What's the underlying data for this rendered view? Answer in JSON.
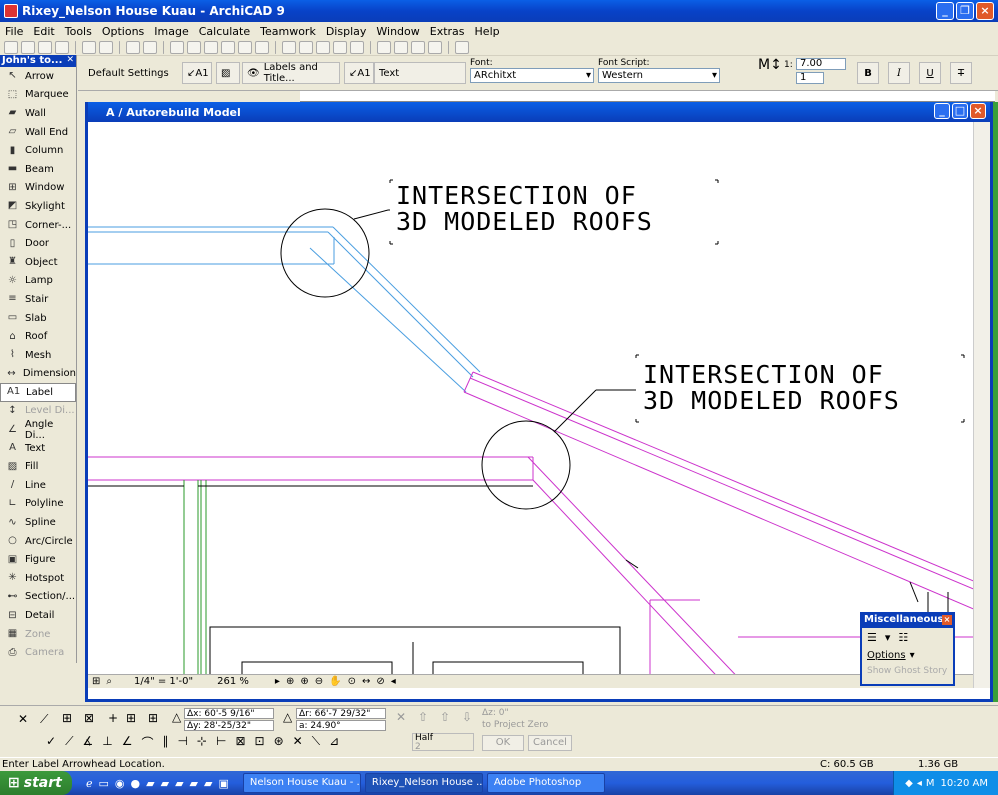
{
  "window": {
    "title": "Rixey_Nelson House Kuau - ArchiCAD 9"
  },
  "menu": [
    "File",
    "Edit",
    "Tools",
    "Options",
    "Image",
    "Calculate",
    "Teamwork",
    "Display",
    "Window",
    "Extras",
    "Help"
  ],
  "toolbox": {
    "title": "John's to...",
    "tools": [
      {
        "label": "Arrow",
        "icon": "arrow-icon",
        "enabled": true
      },
      {
        "label": "Marquee",
        "icon": "marquee-icon",
        "enabled": true
      },
      {
        "label": "Wall",
        "icon": "wall-icon",
        "enabled": true
      },
      {
        "label": "Wall End",
        "icon": "wall-end-icon",
        "enabled": true
      },
      {
        "label": "Column",
        "icon": "column-icon",
        "enabled": true
      },
      {
        "label": "Beam",
        "icon": "beam-icon",
        "enabled": true
      },
      {
        "label": "Window",
        "icon": "window-icon",
        "enabled": true
      },
      {
        "label": "Skylight",
        "icon": "skylight-icon",
        "enabled": true
      },
      {
        "label": "Corner-...",
        "icon": "corner-window-icon",
        "enabled": true
      },
      {
        "label": "Door",
        "icon": "door-icon",
        "enabled": true
      },
      {
        "label": "Object",
        "icon": "object-icon",
        "enabled": true
      },
      {
        "label": "Lamp",
        "icon": "lamp-icon",
        "enabled": true
      },
      {
        "label": "Stair",
        "icon": "stair-icon",
        "enabled": true
      },
      {
        "label": "Slab",
        "icon": "slab-icon",
        "enabled": true
      },
      {
        "label": "Roof",
        "icon": "roof-icon",
        "enabled": true
      },
      {
        "label": "Mesh",
        "icon": "mesh-icon",
        "enabled": true
      },
      {
        "label": "Dimension",
        "icon": "dimension-icon",
        "enabled": true
      },
      {
        "label": "Label",
        "icon": "label-icon",
        "enabled": true,
        "selected": true
      },
      {
        "label": "Level Di...",
        "icon": "level-dimension-icon",
        "enabled": false
      },
      {
        "label": "Angle Di...",
        "icon": "angle-dimension-icon",
        "enabled": true
      },
      {
        "label": "Text",
        "icon": "text-icon",
        "enabled": true
      },
      {
        "label": "Fill",
        "icon": "fill-icon",
        "enabled": true
      },
      {
        "label": "Line",
        "icon": "line-icon",
        "enabled": true
      },
      {
        "label": "Polyline",
        "icon": "polyline-icon",
        "enabled": true
      },
      {
        "label": "Spline",
        "icon": "spline-icon",
        "enabled": true
      },
      {
        "label": "Arc/Circle",
        "icon": "arc-circle-icon",
        "enabled": true
      },
      {
        "label": "Figure",
        "icon": "figure-icon",
        "enabled": true
      },
      {
        "label": "Hotspot",
        "icon": "hotspot-icon",
        "enabled": true
      },
      {
        "label": "Section/...",
        "icon": "section-icon",
        "enabled": true
      },
      {
        "label": "Detail",
        "icon": "detail-icon",
        "enabled": true
      },
      {
        "label": "Zone",
        "icon": "zone-icon",
        "enabled": false
      },
      {
        "label": "Camera",
        "icon": "camera-icon",
        "enabled": false
      }
    ]
  },
  "infobox": {
    "settings": "Default Settings",
    "labels_and_title": "Labels and Title...",
    "label_type": "Text",
    "font_label": "Font:",
    "font_value": "ARchitxt",
    "font_script_label": "Font Script:",
    "font_script_value": "Western",
    "size_label": "1:",
    "size_value": "7.00",
    "pen_value": "1",
    "bold": "B",
    "italic": "I",
    "underline": "U",
    "strike": "T"
  },
  "drawing_window": {
    "title": "A  / Autorebuild Model",
    "annotations": [
      {
        "lines": [
          "INTERSECTION OF",
          "3D MODELED ROOFS"
        ]
      },
      {
        "lines": [
          "INTERSECTION OF",
          "3D MODELED ROOFS"
        ]
      }
    ],
    "scale": "1/4\"   =   1'-0\"",
    "zoom": "261 %"
  },
  "misc_palette": {
    "title": "Miscellaneous",
    "options": "Options",
    "ghost": "Show Ghost Story"
  },
  "coordinates": {
    "dx": "Δx: 60'-5 9/16\"",
    "dy": "Δy: 28'-25/32\"",
    "dr": "Δr: 66'-7 29/32\"",
    "a": "a: 24.90°",
    "dz": "Δz: 0\"",
    "to_project_zero": "to Project Zero",
    "half": "Half",
    "half_num": "2",
    "ok": "OK",
    "cancel": "Cancel"
  },
  "status": {
    "message": "Enter Label Arrowhead Location.",
    "disk_c": "C: 60.5 GB",
    "memory": "1.36 GB"
  },
  "taskbar": {
    "start": "start",
    "tasks": [
      "Nelson House Kuau - ...",
      "Rixey_Nelson House ...",
      "Adobe Photoshop"
    ],
    "time": "10:20 AM"
  }
}
